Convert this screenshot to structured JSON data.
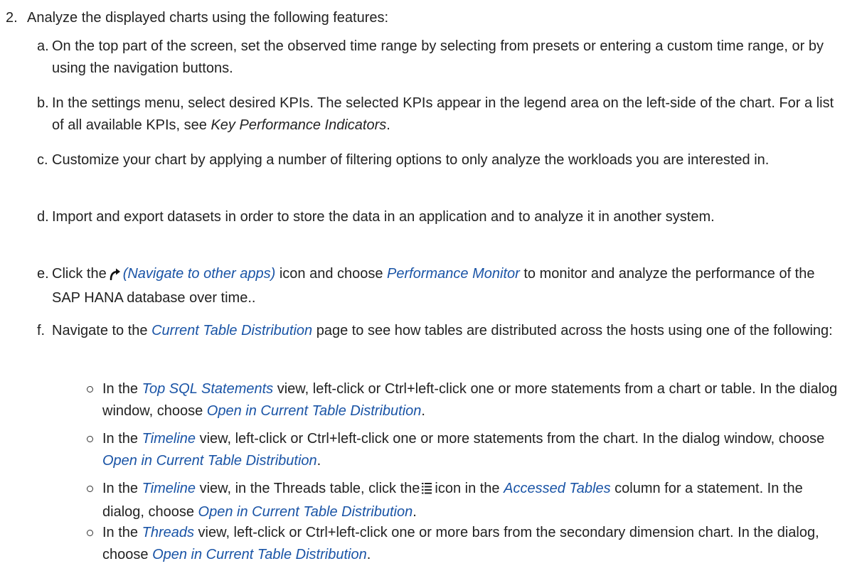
{
  "step": {
    "number": "2.",
    "text": "Analyze the displayed charts using the following features:"
  },
  "items": {
    "a": {
      "letter": "a.",
      "text": "On the top part of the screen, set the observed time range by selecting from presets or entering a custom time range, or by using the navigation buttons."
    },
    "b": {
      "letter": "b.",
      "text1": "In the settings menu, select desired KPIs. The selected KPIs appear in the legend area on the left-side of the chart. For a list of all available KPIs, see ",
      "ref": "Key Performance Indicators",
      "text2": "."
    },
    "c": {
      "letter": "c.",
      "text": "Customize your chart by applying a number of filtering options to only analyze the workloads you are interested in."
    },
    "d": {
      "letter": "d.",
      "text": "Import and export datasets in order to store the data in an application and to analyze it in another system."
    },
    "e": {
      "letter": "e.",
      "text1": "Click the",
      "icon": "navigate-arrow-icon",
      "link1": "(Navigate to other apps)",
      "text2": " icon and choose ",
      "link2": "Performance Monitor",
      "text3": " to monitor and analyze the performance of the SAP HANA database over time.."
    },
    "f": {
      "letter": "f.",
      "text1": "Navigate to the ",
      "link": "Current Table Distribution",
      "text2": " page to see how tables are distributed across the hosts using one of the following:"
    }
  },
  "bullets": {
    "b1": {
      "text1": "In the ",
      "link1": "Top SQL Statements",
      "text2": " view, left-click or Ctrl+left-click one or more statements from a chart or table. In the dialog window, choose ",
      "link2": "Open in Current Table Distribution",
      "text3": "."
    },
    "b2": {
      "text1": "In the ",
      "link1": "Timeline",
      "text2": " view, left-click or Ctrl+left-click one or more statements from the chart. In the dialog window, choose ",
      "link2": "Open in Current Table Distribution",
      "text3": "."
    },
    "b3": {
      "text1": "In the ",
      "link1": "Timeline",
      "text2": " view, in the Threads table, click the",
      "icon": "list-icon",
      "text3": "icon in the ",
      "link2": "Accessed Tables",
      "text4": " column for a statement. In the dialog, choose ",
      "link3": "Open in Current Table Distribution",
      "text5": "."
    },
    "b4": {
      "text1": "In the ",
      "link1": "Threads",
      "text2": " view, left-click or Ctrl+left-click one or more bars from the secondary dimension chart. In the dialog, choose ",
      "link2": "Open in Current Table Distribution",
      "text3": "."
    }
  }
}
